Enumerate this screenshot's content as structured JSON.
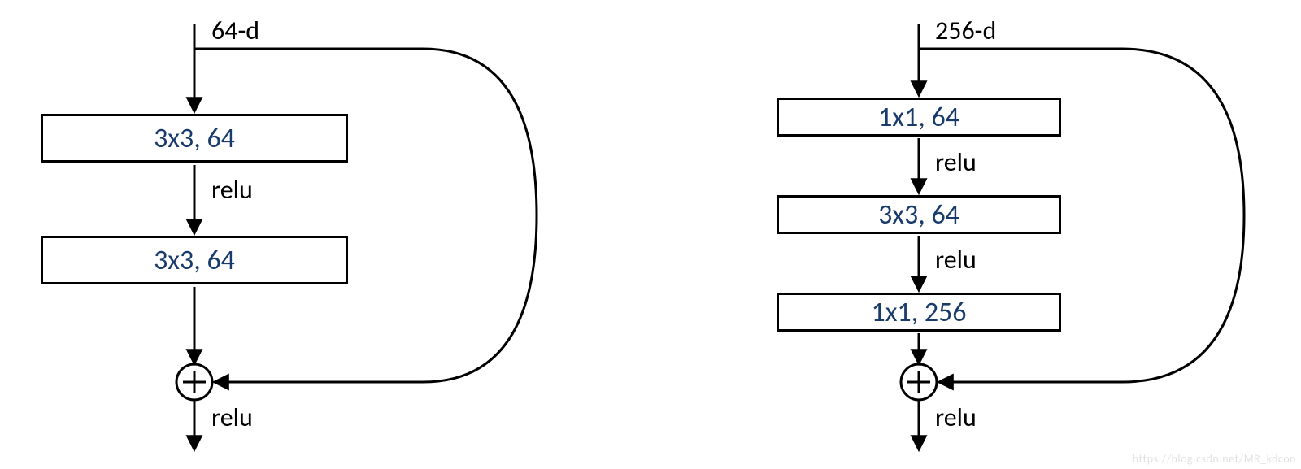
{
  "left": {
    "input_label": "64-d",
    "blocks": [
      "3x3, 64",
      "3x3, 64"
    ],
    "activations": [
      "relu",
      "relu"
    ]
  },
  "right": {
    "input_label": "256-d",
    "blocks": [
      "1x1, 64",
      "3x3, 64",
      "1x1, 256"
    ],
    "activations": [
      "relu",
      "relu",
      "relu"
    ]
  },
  "watermark": "https://blog.csdn.net/MR_kdcon"
}
